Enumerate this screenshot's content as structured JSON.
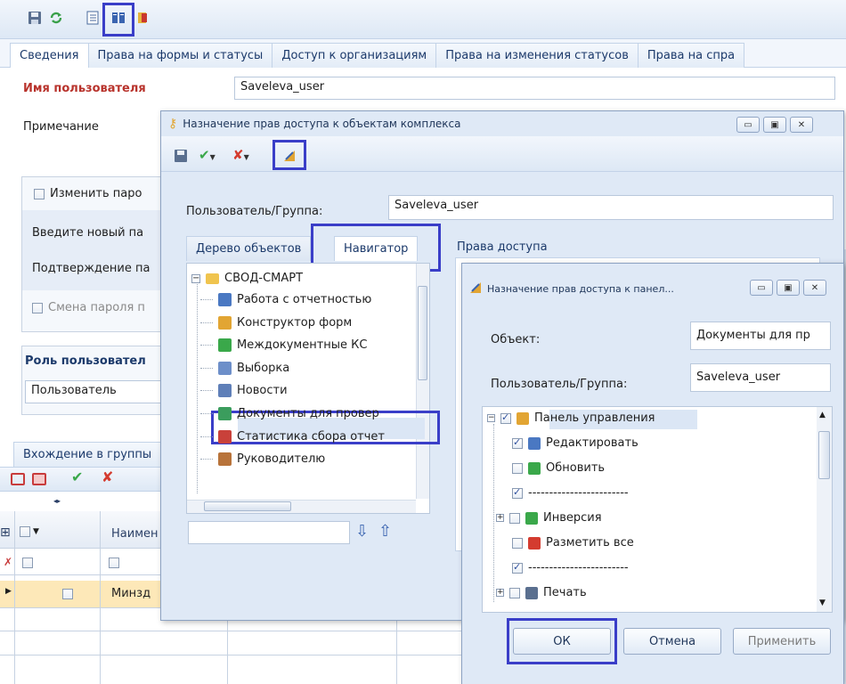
{
  "main": {
    "tabs": [
      "Сведения",
      "Права на формы и статусы",
      "Доступ к организациям",
      "Права на изменения статусов",
      "Права на спра"
    ],
    "username_label": "Имя пользователя",
    "username_value": "Saveleva_user",
    "note_label": "Примечание",
    "change_pwd_label": "Изменить паро",
    "new_pwd_label": "Введите новый па",
    "confirm_pwd_label": "Подтверждение па",
    "pwd_change_label": "Смена пароля п",
    "role_label": "Роль пользовател",
    "role_value": "Пользователь",
    "groups_tab": "Вхождение в группы",
    "grid_header": "Наимен",
    "grid_row": "Минзд"
  },
  "dialog1": {
    "title": "Назначение прав доступа к объектам комплекса",
    "user_label": "Пользователь/Группа:",
    "user_value": "Saveleva_user",
    "tab_tree": "Дерево объектов",
    "tab_nav": "Навигатор",
    "rights_label": "Права доступа",
    "tree_root": "СВОД-СМАРТ",
    "tree_items": [
      {
        "label": "Работа с отчетностью",
        "icon": "report-icon",
        "color": "#4a78c2"
      },
      {
        "label": "Конструктор форм",
        "icon": "designer-icon",
        "color": "#e2a533"
      },
      {
        "label": "Междокументные КС",
        "icon": "crossdoc-icon",
        "color": "#3aa84a"
      },
      {
        "label": "Выборка",
        "icon": "selection-icon",
        "color": "#6d8fc9"
      },
      {
        "label": "Новости",
        "icon": "news-icon",
        "color": "#5f7fb8"
      },
      {
        "label": "Документы для провер",
        "icon": "check-docs-icon",
        "color": "#3b9d5d"
      },
      {
        "label": "Статистика сбора отчет",
        "icon": "stats-icon",
        "color": "#c9413a"
      },
      {
        "label": "Руководителю",
        "icon": "manager-icon",
        "color": "#b8733a"
      }
    ]
  },
  "dialog2": {
    "title": "Назначение прав доступа к панел...",
    "object_label": "Объект:",
    "object_value": "Документы для пр",
    "user_label": "Пользователь/Группа:",
    "user_value": "Saveleva_user",
    "tree": [
      {
        "label": "Панель управления",
        "checked": true,
        "icon": "panel-icon"
      },
      {
        "label": "Редактировать",
        "checked": true,
        "icon": "edit-icon"
      },
      {
        "label": "Обновить",
        "checked": false,
        "icon": "refresh-icon"
      },
      {
        "label": "------------------------",
        "checked": true,
        "icon": ""
      },
      {
        "label": "Инверсия",
        "checked": false,
        "icon": "invert-icon"
      },
      {
        "label": "Разметить все",
        "checked": false,
        "icon": "mark-all-icon"
      },
      {
        "label": "------------------------",
        "checked": true,
        "icon": ""
      },
      {
        "label": "Печать",
        "checked": false,
        "icon": "print-icon"
      }
    ],
    "ok": "ОК",
    "cancel": "Отмена",
    "apply": "Применить"
  }
}
